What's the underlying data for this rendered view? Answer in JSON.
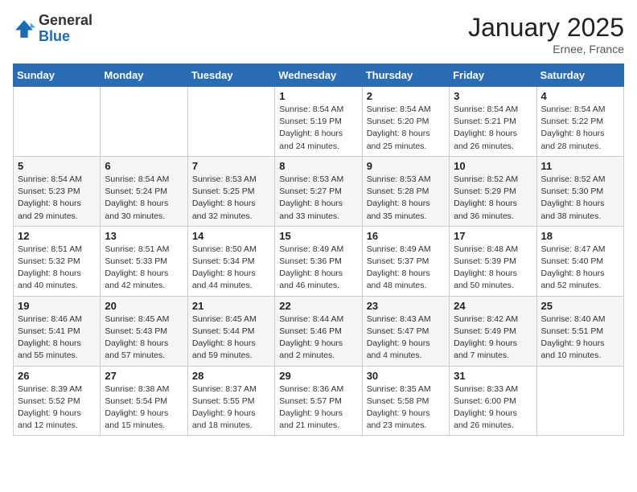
{
  "header": {
    "logo_general": "General",
    "logo_blue": "Blue",
    "month_year": "January 2025",
    "location": "Ernee, France"
  },
  "weekdays": [
    "Sunday",
    "Monday",
    "Tuesday",
    "Wednesday",
    "Thursday",
    "Friday",
    "Saturday"
  ],
  "weeks": [
    [
      {
        "day": "",
        "info": ""
      },
      {
        "day": "",
        "info": ""
      },
      {
        "day": "",
        "info": ""
      },
      {
        "day": "1",
        "info": "Sunrise: 8:54 AM\nSunset: 5:19 PM\nDaylight: 8 hours\nand 24 minutes."
      },
      {
        "day": "2",
        "info": "Sunrise: 8:54 AM\nSunset: 5:20 PM\nDaylight: 8 hours\nand 25 minutes."
      },
      {
        "day": "3",
        "info": "Sunrise: 8:54 AM\nSunset: 5:21 PM\nDaylight: 8 hours\nand 26 minutes."
      },
      {
        "day": "4",
        "info": "Sunrise: 8:54 AM\nSunset: 5:22 PM\nDaylight: 8 hours\nand 28 minutes."
      }
    ],
    [
      {
        "day": "5",
        "info": "Sunrise: 8:54 AM\nSunset: 5:23 PM\nDaylight: 8 hours\nand 29 minutes."
      },
      {
        "day": "6",
        "info": "Sunrise: 8:54 AM\nSunset: 5:24 PM\nDaylight: 8 hours\nand 30 minutes."
      },
      {
        "day": "7",
        "info": "Sunrise: 8:53 AM\nSunset: 5:25 PM\nDaylight: 8 hours\nand 32 minutes."
      },
      {
        "day": "8",
        "info": "Sunrise: 8:53 AM\nSunset: 5:27 PM\nDaylight: 8 hours\nand 33 minutes."
      },
      {
        "day": "9",
        "info": "Sunrise: 8:53 AM\nSunset: 5:28 PM\nDaylight: 8 hours\nand 35 minutes."
      },
      {
        "day": "10",
        "info": "Sunrise: 8:52 AM\nSunset: 5:29 PM\nDaylight: 8 hours\nand 36 minutes."
      },
      {
        "day": "11",
        "info": "Sunrise: 8:52 AM\nSunset: 5:30 PM\nDaylight: 8 hours\nand 38 minutes."
      }
    ],
    [
      {
        "day": "12",
        "info": "Sunrise: 8:51 AM\nSunset: 5:32 PM\nDaylight: 8 hours\nand 40 minutes."
      },
      {
        "day": "13",
        "info": "Sunrise: 8:51 AM\nSunset: 5:33 PM\nDaylight: 8 hours\nand 42 minutes."
      },
      {
        "day": "14",
        "info": "Sunrise: 8:50 AM\nSunset: 5:34 PM\nDaylight: 8 hours\nand 44 minutes."
      },
      {
        "day": "15",
        "info": "Sunrise: 8:49 AM\nSunset: 5:36 PM\nDaylight: 8 hours\nand 46 minutes."
      },
      {
        "day": "16",
        "info": "Sunrise: 8:49 AM\nSunset: 5:37 PM\nDaylight: 8 hours\nand 48 minutes."
      },
      {
        "day": "17",
        "info": "Sunrise: 8:48 AM\nSunset: 5:39 PM\nDaylight: 8 hours\nand 50 minutes."
      },
      {
        "day": "18",
        "info": "Sunrise: 8:47 AM\nSunset: 5:40 PM\nDaylight: 8 hours\nand 52 minutes."
      }
    ],
    [
      {
        "day": "19",
        "info": "Sunrise: 8:46 AM\nSunset: 5:41 PM\nDaylight: 8 hours\nand 55 minutes."
      },
      {
        "day": "20",
        "info": "Sunrise: 8:45 AM\nSunset: 5:43 PM\nDaylight: 8 hours\nand 57 minutes."
      },
      {
        "day": "21",
        "info": "Sunrise: 8:45 AM\nSunset: 5:44 PM\nDaylight: 8 hours\nand 59 minutes."
      },
      {
        "day": "22",
        "info": "Sunrise: 8:44 AM\nSunset: 5:46 PM\nDaylight: 9 hours\nand 2 minutes."
      },
      {
        "day": "23",
        "info": "Sunrise: 8:43 AM\nSunset: 5:47 PM\nDaylight: 9 hours\nand 4 minutes."
      },
      {
        "day": "24",
        "info": "Sunrise: 8:42 AM\nSunset: 5:49 PM\nDaylight: 9 hours\nand 7 minutes."
      },
      {
        "day": "25",
        "info": "Sunrise: 8:40 AM\nSunset: 5:51 PM\nDaylight: 9 hours\nand 10 minutes."
      }
    ],
    [
      {
        "day": "26",
        "info": "Sunrise: 8:39 AM\nSunset: 5:52 PM\nDaylight: 9 hours\nand 12 minutes."
      },
      {
        "day": "27",
        "info": "Sunrise: 8:38 AM\nSunset: 5:54 PM\nDaylight: 9 hours\nand 15 minutes."
      },
      {
        "day": "28",
        "info": "Sunrise: 8:37 AM\nSunset: 5:55 PM\nDaylight: 9 hours\nand 18 minutes."
      },
      {
        "day": "29",
        "info": "Sunrise: 8:36 AM\nSunset: 5:57 PM\nDaylight: 9 hours\nand 21 minutes."
      },
      {
        "day": "30",
        "info": "Sunrise: 8:35 AM\nSunset: 5:58 PM\nDaylight: 9 hours\nand 23 minutes."
      },
      {
        "day": "31",
        "info": "Sunrise: 8:33 AM\nSunset: 6:00 PM\nDaylight: 9 hours\nand 26 minutes."
      },
      {
        "day": "",
        "info": ""
      }
    ]
  ]
}
